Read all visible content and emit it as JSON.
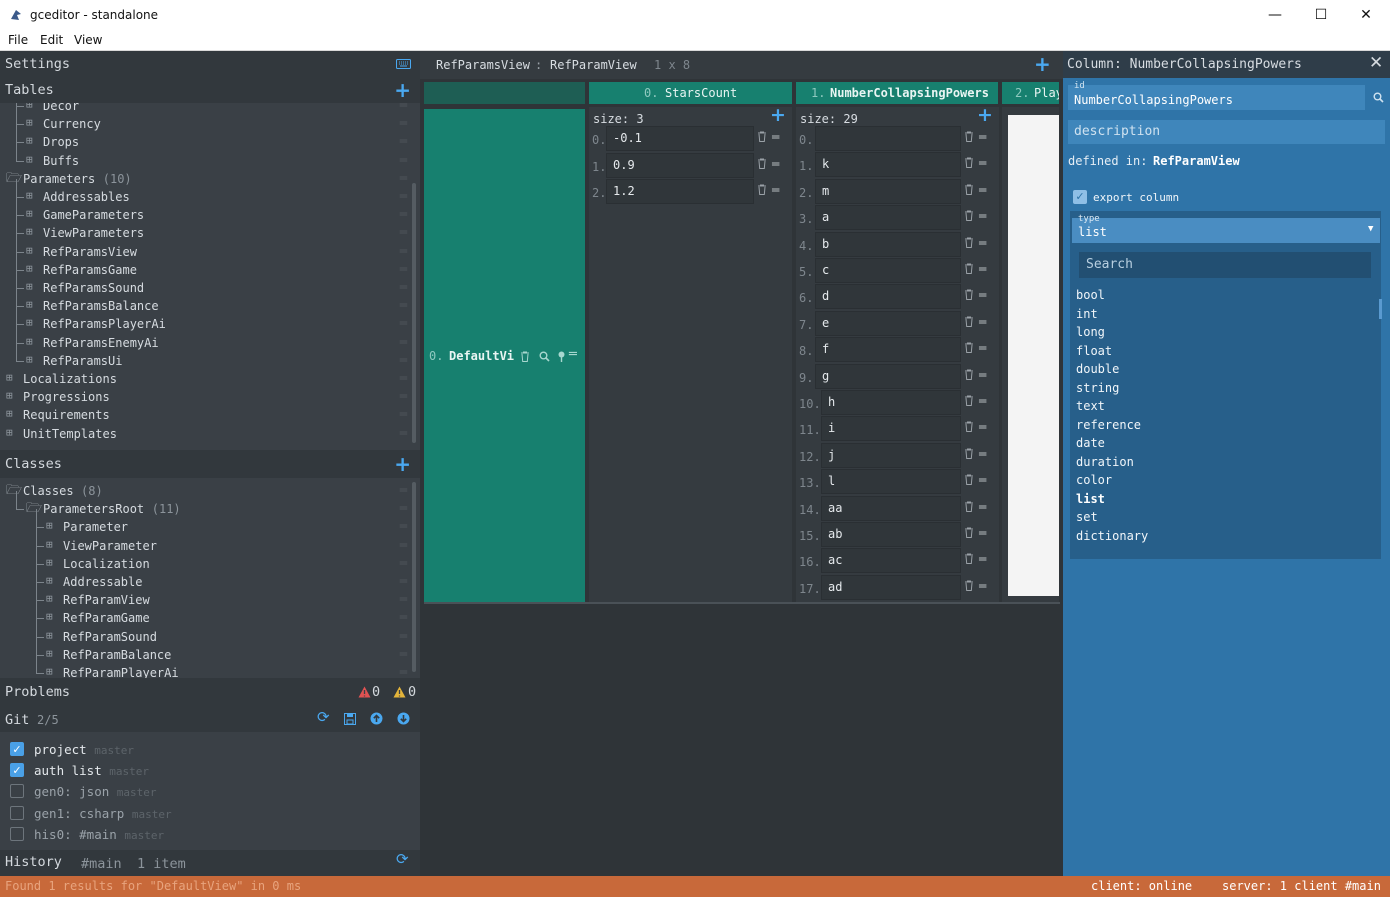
{
  "window": {
    "title": "gceditor - standalone",
    "min": "—",
    "max": "☐",
    "close": "✕"
  },
  "menu": [
    "File",
    "Edit",
    "View"
  ],
  "settings": {
    "label": "Settings"
  },
  "tables": {
    "label": "Tables",
    "items": [
      {
        "name": "Decor",
        "depth": 2
      },
      {
        "name": "Currency",
        "depth": 2
      },
      {
        "name": "Drops",
        "depth": 2
      },
      {
        "name": "Buffs",
        "depth": 2
      },
      {
        "name": "Parameters",
        "count": "(10)",
        "depth": 1,
        "folder": true
      },
      {
        "name": "Addressables",
        "depth": 2
      },
      {
        "name": "GameParameters",
        "depth": 2
      },
      {
        "name": "ViewParameters",
        "depth": 2
      },
      {
        "name": "RefParamsView",
        "depth": 2
      },
      {
        "name": "RefParamsGame",
        "depth": 2
      },
      {
        "name": "RefParamsSound",
        "depth": 2
      },
      {
        "name": "RefParamsBalance",
        "depth": 2
      },
      {
        "name": "RefParamsPlayerAi",
        "depth": 2
      },
      {
        "name": "RefParamsEnemyAi",
        "depth": 2
      },
      {
        "name": "RefParamsUi",
        "depth": 2
      },
      {
        "name": "Localizations",
        "depth": 1
      },
      {
        "name": "Progressions",
        "depth": 1
      },
      {
        "name": "Requirements",
        "depth": 1
      },
      {
        "name": "UnitTemplates",
        "depth": 1
      }
    ]
  },
  "classes": {
    "label": "Classes",
    "items": [
      {
        "name": "Classes",
        "count": "(8)",
        "depth": 1,
        "folder": true
      },
      {
        "name": "ParametersRoot",
        "count": "(11)",
        "depth": 2,
        "folder": true
      },
      {
        "name": "Parameter",
        "depth": 3
      },
      {
        "name": "ViewParameter",
        "depth": 3
      },
      {
        "name": "Localization",
        "depth": 3
      },
      {
        "name": "Addressable",
        "depth": 3
      },
      {
        "name": "RefParamView",
        "depth": 3
      },
      {
        "name": "RefParamGame",
        "depth": 3
      },
      {
        "name": "RefParamSound",
        "depth": 3
      },
      {
        "name": "RefParamBalance",
        "depth": 3
      },
      {
        "name": "RefParamPlayerAi",
        "depth": 3
      }
    ]
  },
  "problems": {
    "label": "Problems",
    "errors": "0",
    "warnings": "0"
  },
  "git": {
    "label": "Git",
    "count": "2/5",
    "items": [
      {
        "name": "project",
        "branch": "master",
        "checked": true
      },
      {
        "name": "auth list",
        "branch": "master",
        "checked": true
      },
      {
        "name": "gen0: json",
        "branch": "master",
        "checked": false
      },
      {
        "name": "gen1: csharp",
        "branch": "master",
        "checked": false
      },
      {
        "name": "his0: #main",
        "branch": "master",
        "checked": false
      }
    ]
  },
  "history": {
    "label": "History",
    "branch": "#main",
    "count": "1 item"
  },
  "table_view": {
    "table": "RefParamsView",
    "sep": ":",
    "class": "RefParamView",
    "dims": "1 x 8",
    "columns": [
      {
        "index": "0.",
        "name": "StarsCount"
      },
      {
        "index": "1.",
        "name": "NumberCollapsingPowers"
      },
      {
        "index": "2.",
        "name": "Play"
      }
    ],
    "row": {
      "index": "0.",
      "id": "DefaultVi"
    },
    "stars": {
      "size": "size: 3",
      "values": [
        "-0.1",
        "0.9",
        "1.2"
      ]
    },
    "powers": {
      "size": "size: 29",
      "values": [
        "",
        "k",
        "m",
        "a",
        "b",
        "c",
        "d",
        "e",
        "f",
        "g",
        "h",
        "i",
        "j",
        "l",
        "aa",
        "ab",
        "ac",
        "ad"
      ]
    }
  },
  "column_panel": {
    "title": "Column: NumberCollapsingPowers",
    "id_label": "id",
    "id_value": "NumberCollapsingPowers",
    "description_placeholder": "description",
    "defined_in_label": "defined in:",
    "defined_in_value": "RefParamView",
    "export_label": "export column",
    "type_label": "type",
    "type_value": "list",
    "search_placeholder": "Search",
    "type_options": [
      "bool",
      "int",
      "long",
      "float",
      "double",
      "string",
      "text",
      "reference",
      "date",
      "duration",
      "color",
      "list",
      "set",
      "dictionary"
    ],
    "selected_option": "list"
  },
  "status": {
    "message": "Found 1 results for \"DefaultView\" in 0 ms",
    "client": "client: online",
    "server": "server: 1 client #main"
  },
  "colors": {
    "teal": "#17806f",
    "blue_panel": "#2f74a8",
    "accent": "#4aa8f0",
    "status_bar": "#c8693a"
  }
}
